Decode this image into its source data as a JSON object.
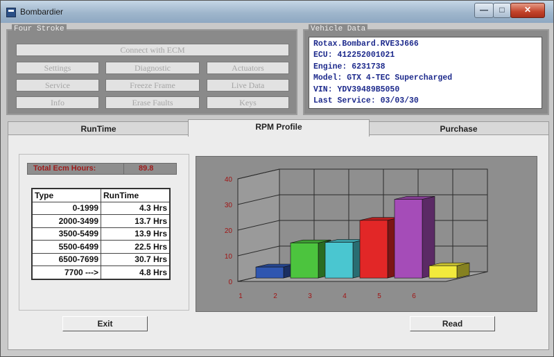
{
  "window": {
    "title": "Bombardier",
    "min_glyph": "—",
    "max_glyph": "□",
    "close_glyph": "✕"
  },
  "four_stroke": {
    "label": "Four Stroke",
    "connect": "Connect with ECM",
    "buttons": [
      {
        "name": "settings-button",
        "label": "Settings"
      },
      {
        "name": "diagnostic-button",
        "label": "Diagnostic"
      },
      {
        "name": "actuators-button",
        "label": "Actuators"
      },
      {
        "name": "service-button",
        "label": "Service"
      },
      {
        "name": "freeze-frame-button",
        "label": "Freeze Frame"
      },
      {
        "name": "live-data-button",
        "label": "Live Data"
      },
      {
        "name": "info-button",
        "label": "Info"
      },
      {
        "name": "erase-faults-button",
        "label": "Erase Faults"
      },
      {
        "name": "keys-button",
        "label": "Keys"
      }
    ]
  },
  "vehicle": {
    "label": "Vehicle Data",
    "lines": [
      "Rotax.Bombard.RVE3J666",
      "ECU: 412252001021",
      "Engine: 6231738",
      "Model: GTX 4-TEC Supercharged",
      "VIN: YDV39489B5050",
      "Last Service: 03/03/30"
    ]
  },
  "tabs": [
    "RunTime",
    "RPM Profile",
    "Purchase"
  ],
  "ecm_hours": {
    "label": "Total Ecm Hours:",
    "value": "89.8"
  },
  "runtime_table": {
    "headers": [
      "Type",
      "RunTime"
    ],
    "rows": [
      [
        "0-1999",
        "4.3 Hrs"
      ],
      [
        "2000-3499",
        "13.7 Hrs"
      ],
      [
        "3500-5499",
        "13.9 Hrs"
      ],
      [
        "5500-6499",
        "22.5 Hrs"
      ],
      [
        "6500-7699",
        "30.7 Hrs"
      ],
      [
        "7700 --->",
        "4.8 Hrs"
      ]
    ]
  },
  "chart_data": {
    "type": "bar",
    "categories": [
      "1",
      "2",
      "3",
      "4",
      "5",
      "6"
    ],
    "values": [
      4.3,
      13.7,
      13.9,
      22.5,
      30.7,
      4.8
    ],
    "ylim": [
      0,
      40
    ],
    "yticks": [
      "0",
      "10",
      "20",
      "30",
      "40"
    ],
    "colors": [
      "#2f56b0",
      "#4cc43e",
      "#4ac6d0",
      "#e22727",
      "#a54cb8",
      "#f2ea3c"
    ],
    "grid": true,
    "title": "",
    "xlabel": "",
    "ylabel": ""
  },
  "actions": {
    "exit": "Exit",
    "read": "Read"
  }
}
